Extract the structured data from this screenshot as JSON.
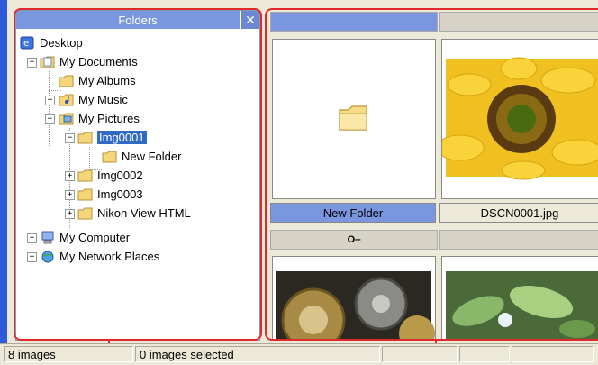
{
  "folders_panel": {
    "title": "Folders",
    "close_glyph": "✕",
    "items": [
      {
        "label": "Desktop"
      },
      {
        "label": "My Documents"
      },
      {
        "label": "My Albums"
      },
      {
        "label": "My Music"
      },
      {
        "label": "My Pictures"
      },
      {
        "label": "Img0001"
      },
      {
        "label": "New Folder"
      },
      {
        "label": "Img0002"
      },
      {
        "label": "Img0003"
      },
      {
        "label": "Nikon View HTML"
      },
      {
        "label": "My Computer"
      },
      {
        "label": "My Network Places"
      }
    ]
  },
  "thumbnails": {
    "items": [
      {
        "caption": "New Folder",
        "kind": "folder-icon"
      },
      {
        "caption": "DSCN0001.jpg",
        "kind": "sunflower-photo"
      },
      {
        "caption": "",
        "kind": "gears-photo",
        "protected_glyph": "O‒"
      },
      {
        "caption": "",
        "kind": "leaves-photo"
      }
    ]
  },
  "status_bar": {
    "image_count": "8 images",
    "selected_count": "0 images selected"
  },
  "colors": {
    "title_bar": "#7a96df",
    "selection": "#316ac5",
    "highlight_outline": "#e0292b",
    "window_bg": "#ece9d8"
  }
}
